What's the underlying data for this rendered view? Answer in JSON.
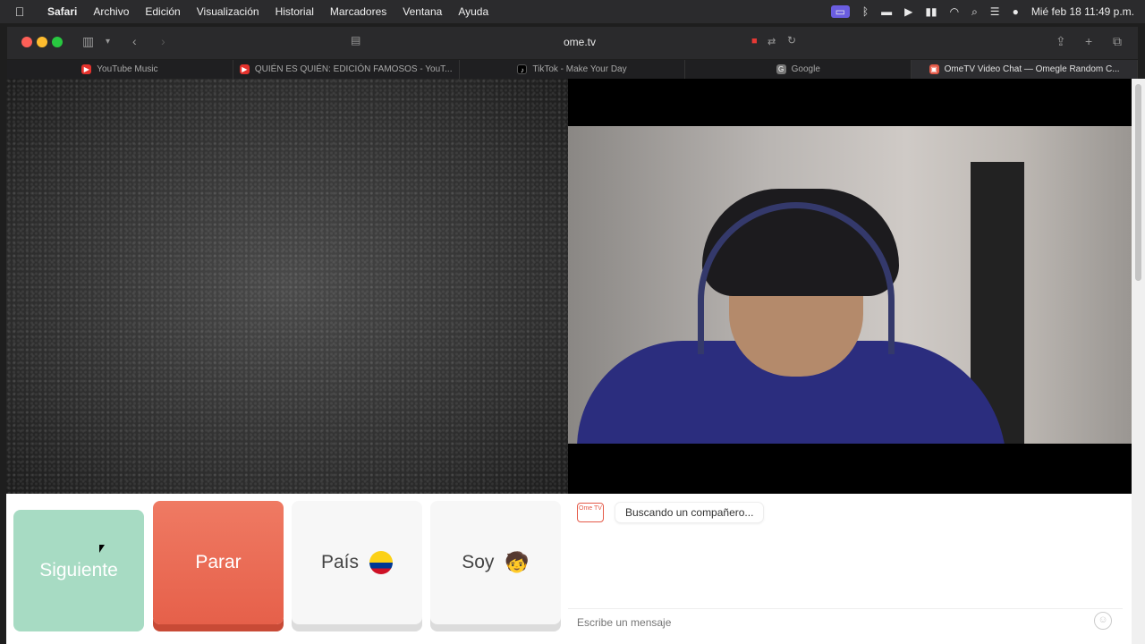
{
  "menubar": {
    "app": "Safari",
    "items": [
      "Archivo",
      "Edición",
      "Visualización",
      "Historial",
      "Marcadores",
      "Ventana",
      "Ayuda"
    ],
    "clock": "Mié feb 18  11:49 p.m."
  },
  "browser": {
    "url": "ome.tv",
    "tabs": [
      {
        "label": "YouTube Music",
        "icon": "youtube-music-icon",
        "color": "#e5322d"
      },
      {
        "label": "QUIÉN ES QUIÉN: EDICIÓN FAMOSOS - YouT...",
        "icon": "youtube-icon",
        "color": "#e5322d"
      },
      {
        "label": "TikTok - Make Your Day",
        "icon": "tiktok-icon",
        "color": "#000000"
      },
      {
        "label": "Google",
        "icon": "google-icon",
        "color": "#777777"
      },
      {
        "label": "OmeTV Video Chat — Omegle Random C...",
        "icon": "ometv-icon",
        "color": "#e55a48",
        "active": true
      }
    ]
  },
  "controls": {
    "next_label": "Siguiente",
    "stop_label": "Parar",
    "country_label": "País",
    "gender_label": "Soy",
    "gender_emoji": "🧒"
  },
  "chat": {
    "logo_text": "Ome TV",
    "status_message": "Buscando un compañero...",
    "input_placeholder": "Escribe un mensaje"
  },
  "colors": {
    "next": "#a7dbc3",
    "stop": "#e6604a",
    "accent": "#e55a48"
  }
}
